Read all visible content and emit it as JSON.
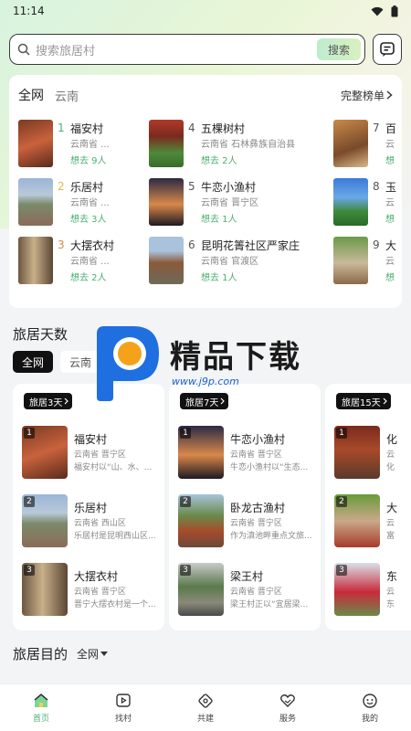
{
  "status": {
    "time": "11:14"
  },
  "search": {
    "placeholder": "搜索旅居村",
    "button": "搜索"
  },
  "ranking": {
    "tab_active": "全网",
    "tab_region": "云南",
    "more": "完整榜单",
    "items": [
      {
        "num": "1",
        "name": "福安村",
        "region": "云南省 ...",
        "want": "想去 9人"
      },
      {
        "num": "2",
        "name": "乐居村",
        "region": "云南省 ...",
        "want": "想去 3人"
      },
      {
        "num": "3",
        "name": "大摆衣村",
        "region": "云南省 ...",
        "want": "想去 2人"
      },
      {
        "num": "4",
        "name": "五棵树村",
        "region": "云南省 石林彝族自治县",
        "want": "想去 2人"
      },
      {
        "num": "5",
        "name": "牛恋小渔村",
        "region": "云南省 晋宁区",
        "want": "想去 1人"
      },
      {
        "num": "6",
        "name": "昆明花箐社区严家庄",
        "region": "云南省 官渡区",
        "want": "想去 1人"
      },
      {
        "num": "7",
        "name": "百",
        "region": "云",
        "want": "想"
      },
      {
        "num": "8",
        "name": "玉",
        "region": "云",
        "want": "想"
      },
      {
        "num": "9",
        "name": "大",
        "region": "云",
        "want": "想"
      }
    ]
  },
  "days": {
    "title": "旅居天数",
    "filters": [
      "全网",
      "云南"
    ],
    "cards": [
      {
        "tag": "旅居3天",
        "items": [
          {
            "rank": "1",
            "name": "福安村",
            "region": "云南省 晋宁区",
            "desc": "福安村以“山、水、..."
          },
          {
            "rank": "2",
            "name": "乐居村",
            "region": "云南省 西山区",
            "desc": "乐居村是昆明西山区..."
          },
          {
            "rank": "3",
            "name": "大摆衣村",
            "region": "云南省 晋宁区",
            "desc": "晋宁大摆衣村是一个..."
          }
        ]
      },
      {
        "tag": "旅居7天",
        "items": [
          {
            "rank": "1",
            "name": "牛恋小渔村",
            "region": "云南省 晋宁区",
            "desc": "牛恋小渔村以“生态..."
          },
          {
            "rank": "2",
            "name": "卧龙古渔村",
            "region": "云南省 晋宁区",
            "desc": "作为滇池畔重点文旅..."
          },
          {
            "rank": "3",
            "name": "梁王村",
            "region": "云南省 晋宁区",
            "desc": "梁王村正以“宜居梁..."
          }
        ]
      },
      {
        "tag": "旅居15天",
        "items": [
          {
            "rank": "1",
            "name": "化",
            "region": "云",
            "desc": "化"
          },
          {
            "rank": "2",
            "name": "大",
            "region": "云",
            "desc": "富"
          },
          {
            "rank": "3",
            "name": "东",
            "region": "云",
            "desc": "东"
          }
        ]
      }
    ]
  },
  "destination": {
    "title": "旅居目的",
    "filter": "全网"
  },
  "watermark": {
    "text": "精品下载",
    "url": "www.j9p.com"
  },
  "tabbar": [
    {
      "label": "首页",
      "icon": "home-icon"
    },
    {
      "label": "找村",
      "icon": "play-square-icon"
    },
    {
      "label": "共建",
      "icon": "diamond-pin-icon"
    },
    {
      "label": "服务",
      "icon": "heart-hand-icon"
    },
    {
      "label": "我的",
      "icon": "smiley-icon"
    }
  ],
  "colors": {
    "accent": "#4caf73",
    "dark": "#111111"
  }
}
